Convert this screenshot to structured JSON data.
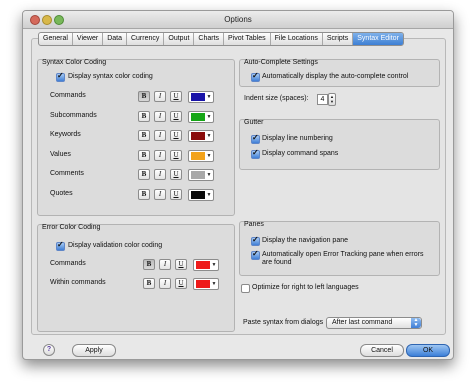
{
  "window": {
    "title": "Options"
  },
  "tabs": [
    {
      "label": "General"
    },
    {
      "label": "Viewer"
    },
    {
      "label": "Data"
    },
    {
      "label": "Currency"
    },
    {
      "label": "Output"
    },
    {
      "label": "Charts"
    },
    {
      "label": "Pivot Tables"
    },
    {
      "label": "File Locations"
    },
    {
      "label": "Scripts"
    },
    {
      "label": "Syntax Editor"
    }
  ],
  "active_tab": "Syntax Editor",
  "syntax_color": {
    "title": "Syntax Color Coding",
    "display_label": "Display syntax color coding",
    "display_checked": true,
    "rows": [
      {
        "label": "Commands",
        "color": "#1a14a8",
        "bold": true
      },
      {
        "label": "Subcommands",
        "color": "#16a616",
        "bold": false
      },
      {
        "label": "Keywords",
        "color": "#8a0c0c",
        "bold": false
      },
      {
        "label": "Values",
        "color": "#f2a21a",
        "bold": false
      },
      {
        "label": "Comments",
        "color": "#a8a8a8",
        "bold": false
      },
      {
        "label": "Quotes",
        "color": "#0a0a0a",
        "bold": false
      }
    ],
    "font_buttons": {
      "bold": "B",
      "italic": "I",
      "underline": "U"
    }
  },
  "error_color": {
    "title": "Error Color Coding",
    "display_label": "Display validation color coding",
    "display_checked": true,
    "rows": [
      {
        "label": "Commands",
        "color": "#ee1a1a",
        "bold": true
      },
      {
        "label": "Within commands",
        "color": "#ee1a1a",
        "bold": false
      }
    ]
  },
  "autocomplete": {
    "title": "Auto-Complete Settings",
    "label": "Automatically display the auto-complete control",
    "checked": true
  },
  "indent": {
    "label": "Indent size (spaces):",
    "value": "4"
  },
  "gutter": {
    "title": "Gutter",
    "items": [
      {
        "label": "Display line numbering",
        "checked": true
      },
      {
        "label": "Display command spans",
        "checked": true
      }
    ]
  },
  "panes": {
    "title": "Panes",
    "items": [
      {
        "label": "Display the navigation pane",
        "checked": true
      },
      {
        "label": "Automatically open Error Tracking pane when errors are found",
        "checked": true
      }
    ],
    "line2": "are found"
  },
  "rtl": {
    "label": "Optimize for right to left languages",
    "checked": false
  },
  "paste": {
    "label": "Paste syntax from dialogs",
    "selected": "After last command"
  },
  "buttons": {
    "help": "?",
    "apply": "Apply",
    "cancel": "Cancel",
    "ok": "OK"
  },
  "icons": {
    "close": "window-close-icon",
    "minimize": "window-minimize-icon",
    "zoom": "window-zoom-icon",
    "help": "help-icon"
  }
}
